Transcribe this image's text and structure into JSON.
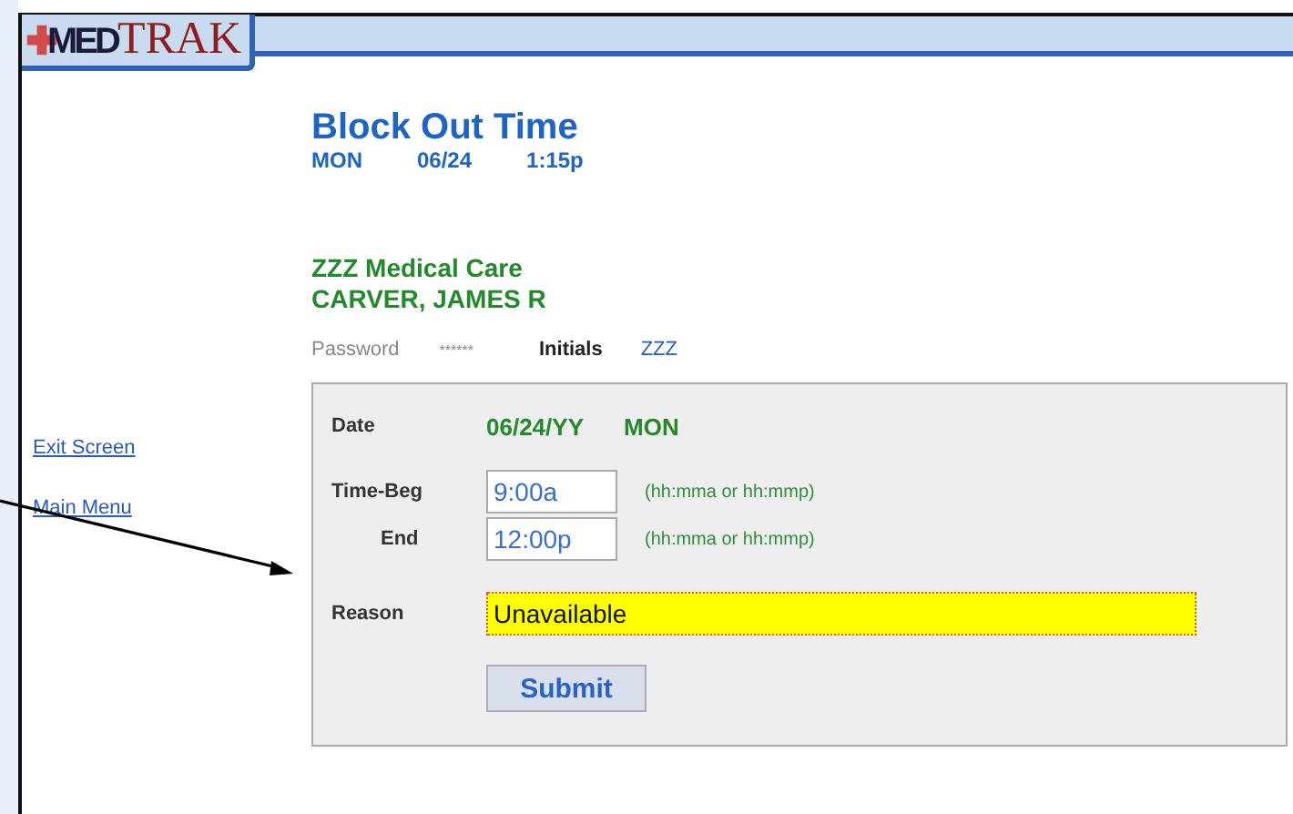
{
  "logo": {
    "part_1": "MED",
    "part_2": "TRAK"
  },
  "header": {
    "title": "Block Out Time",
    "day": "MON",
    "date": "06/24",
    "time": "1:15p"
  },
  "practice": {
    "name": "ZZZ Medical Care",
    "provider": "CARVER, JAMES R"
  },
  "credentials": {
    "password_label": "Password",
    "password_value": "******",
    "initials_label": "Initials",
    "initials_value": "ZZZ"
  },
  "sidebar": {
    "links": [
      "Exit Screen",
      "Main Menu"
    ]
  },
  "form": {
    "date_label": "Date",
    "date_value": "06/24/YY",
    "day_value": "MON",
    "time_fields": [
      {
        "label": "Time-Beg",
        "value": "9:00a",
        "hint": "(hh:mma or hh:mmp)"
      },
      {
        "label": "End",
        "value": "12:00p",
        "hint": "(hh:mma or hh:mmp)"
      }
    ],
    "reason_label": "Reason",
    "reason_value": "Unavailable",
    "reason_focused": true,
    "submit": "Submit"
  }
}
